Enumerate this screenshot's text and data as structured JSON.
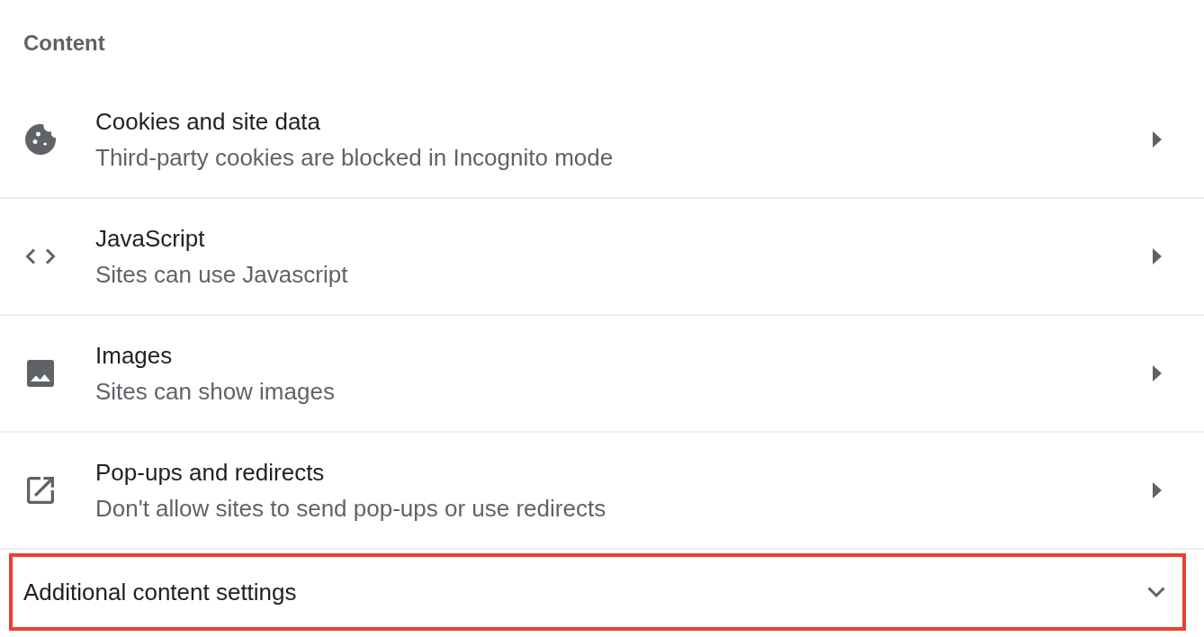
{
  "section": {
    "title": "Content"
  },
  "settings": [
    {
      "title": "Cookies and site data",
      "subtitle": "Third-party cookies are blocked in Incognito mode"
    },
    {
      "title": "JavaScript",
      "subtitle": "Sites can use Javascript"
    },
    {
      "title": "Images",
      "subtitle": "Sites can show images"
    },
    {
      "title": "Pop-ups and redirects",
      "subtitle": "Don't allow sites to send pop-ups or use redirects"
    }
  ],
  "additional": {
    "label": "Additional content settings",
    "expanded": false,
    "highlighted": true
  }
}
